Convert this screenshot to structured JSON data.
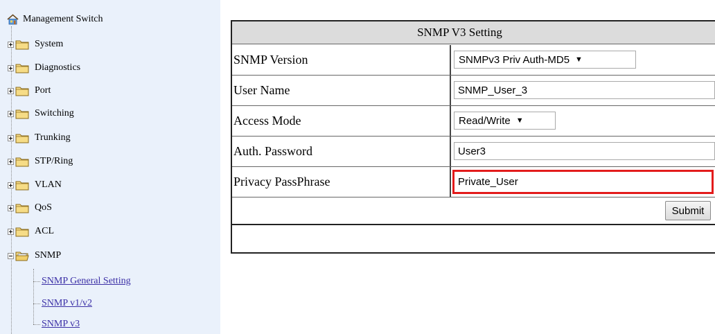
{
  "sidebar": {
    "root_label": "Management Switch",
    "items": [
      {
        "label": "System",
        "expanded": false
      },
      {
        "label": "Diagnostics",
        "expanded": false
      },
      {
        "label": "Port",
        "expanded": false
      },
      {
        "label": "Switching",
        "expanded": false
      },
      {
        "label": "Trunking",
        "expanded": false
      },
      {
        "label": "STP/Ring",
        "expanded": false
      },
      {
        "label": "VLAN",
        "expanded": false
      },
      {
        "label": "QoS",
        "expanded": false
      },
      {
        "label": "ACL",
        "expanded": false
      },
      {
        "label": "SNMP",
        "expanded": true
      }
    ],
    "snmp_children": [
      {
        "label": "SNMP General Setting"
      },
      {
        "label": "SNMP v1/v2"
      },
      {
        "label": "SNMP v3"
      }
    ]
  },
  "panel": {
    "title": "SNMP V3 Setting",
    "rows": [
      {
        "label": "SNMP Version",
        "value": "SNMPv3 Priv Auth-MD5"
      },
      {
        "label": "User Name",
        "value": "SNMP_User_3"
      },
      {
        "label": "Access Mode",
        "value": "Read/Write"
      },
      {
        "label": "Auth. Password",
        "value": "User3"
      },
      {
        "label": "Privacy PassPhrase",
        "value": "Private_User"
      }
    ],
    "submit_label": "Submit"
  },
  "colors": {
    "sidebar_bg": "#eaf1fb",
    "title_bg": "#dcdcdc",
    "link": "#3b2fa6",
    "highlight": "#e31b1b",
    "folder": "#e8c45a"
  },
  "icons": {
    "root": "management-switch-icon",
    "folder": "folder-icon",
    "open_folder": "open-folder-icon",
    "select_arrow": "▼"
  }
}
